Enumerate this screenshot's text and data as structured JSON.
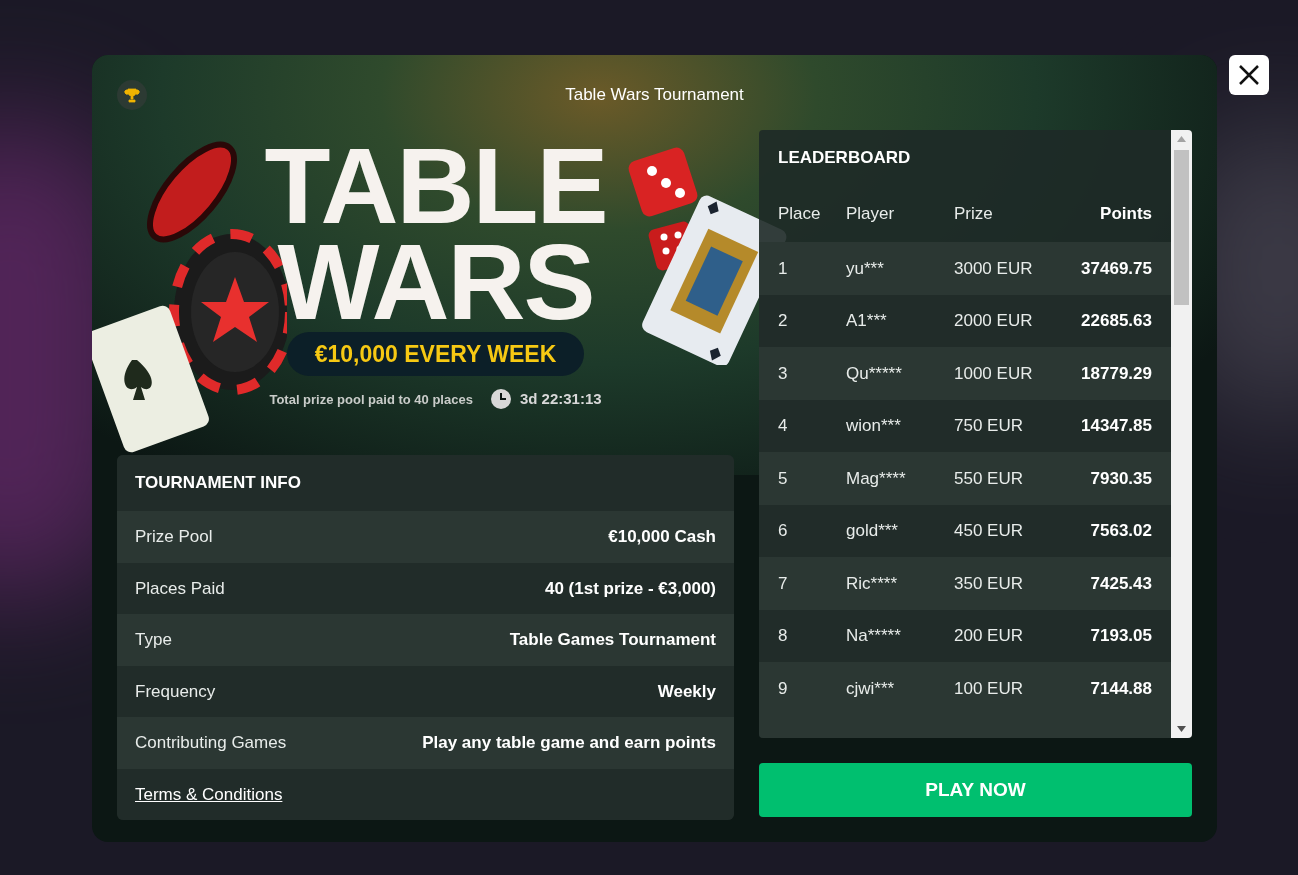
{
  "header": {
    "title": "Table Wars Tournament"
  },
  "banner": {
    "headline_lines": [
      "TABLE",
      "WARS"
    ],
    "prize_badge": "€10,000 EVERY WEEK",
    "prize_note": "Total prize pool paid to 40 places",
    "countdown": "3d 22:31:13"
  },
  "tournament_info": {
    "title": "TOURNAMENT INFO",
    "rows": [
      {
        "label": "Prize Pool",
        "value": "€10,000 Cash"
      },
      {
        "label": "Places Paid",
        "value": "40 (1st prize - €3,000)"
      },
      {
        "label": "Type",
        "value": "Table Games Tournament"
      },
      {
        "label": "Frequency",
        "value": "Weekly"
      },
      {
        "label": "Contributing Games",
        "value": "Play any table game and earn points"
      }
    ],
    "terms_link": "Terms & Conditions"
  },
  "leaderboard": {
    "title": "LEADERBOARD",
    "columns": [
      "Place",
      "Player",
      "Prize",
      "Points"
    ],
    "rows": [
      [
        "1",
        "yu***",
        "3000 EUR",
        "37469.75"
      ],
      [
        "2",
        "A1***",
        "2000 EUR",
        "22685.63"
      ],
      [
        "3",
        "Qu*****",
        "1000 EUR",
        "18779.29"
      ],
      [
        "4",
        "wion***",
        "750 EUR",
        "14347.85"
      ],
      [
        "5",
        "Mag****",
        "550 EUR",
        "7930.35"
      ],
      [
        "6",
        "gold***",
        "450 EUR",
        "7563.02"
      ],
      [
        "7",
        "Ric****",
        "350 EUR",
        "7425.43"
      ],
      [
        "8",
        "Na*****",
        "200 EUR",
        "7193.05"
      ],
      [
        "9",
        "cjwi***",
        "100 EUR",
        "7144.88"
      ]
    ]
  },
  "play_button": "PLAY NOW"
}
